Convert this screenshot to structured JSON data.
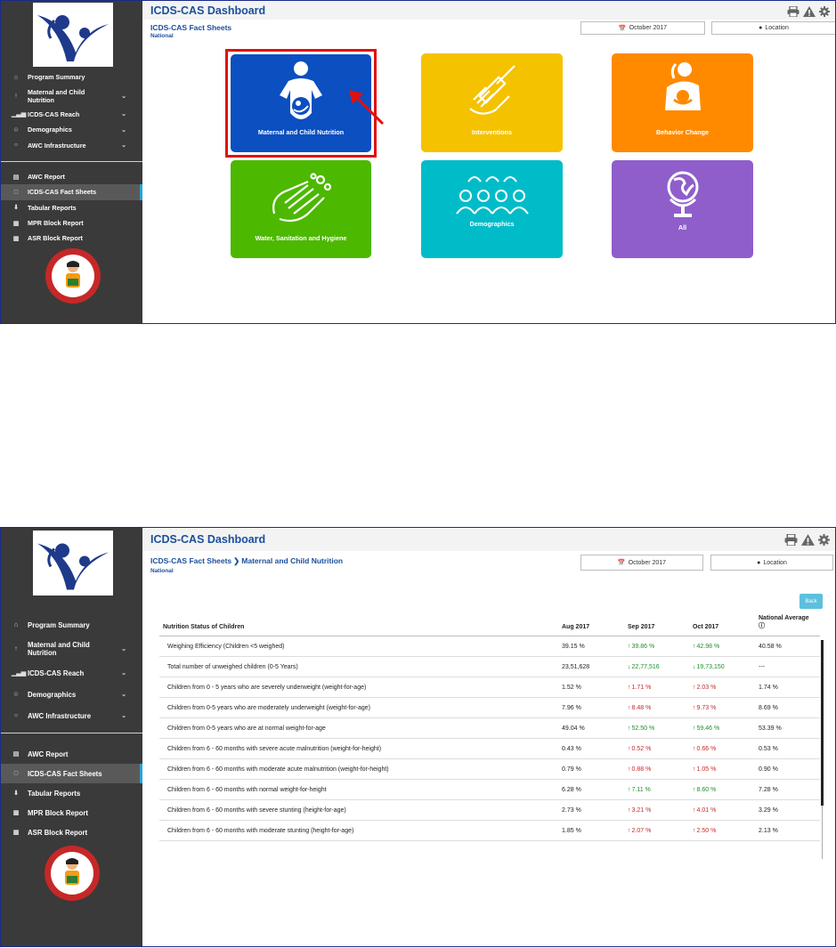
{
  "sidebar": {
    "nav_primary": [
      {
        "label": "Program Summary",
        "icon": "home-icon",
        "chevron": false
      },
      {
        "label": "Maternal and Child Nutrition",
        "icon": "child-icon",
        "chevron": true
      },
      {
        "label": "ICDS-CAS Reach",
        "icon": "bar-chart-icon",
        "chevron": true
      },
      {
        "label": "Demographics",
        "icon": "users-icon",
        "chevron": true
      },
      {
        "label": "AWC Infrastructure",
        "icon": "bulb-icon",
        "chevron": true
      }
    ],
    "nav_secondary": [
      {
        "label": "AWC Report",
        "icon": "report-icon",
        "active": false
      },
      {
        "label": "ICDS-CAS Fact Sheets",
        "icon": "file-icon",
        "active": true
      },
      {
        "label": "Tabular Reports",
        "icon": "download-icon",
        "active": false
      },
      {
        "label": "MPR Block Report",
        "icon": "grid-icon",
        "active": false
      },
      {
        "label": "ASR Block Report",
        "icon": "grid-icon",
        "active": false
      }
    ]
  },
  "screen1": {
    "title": "ICDS-CAS Dashboard",
    "subtitle": "ICDS-CAS Fact Sheets",
    "scope": "National",
    "date_button": "October 2017",
    "location_button": "Location",
    "tiles": [
      {
        "label": "Maternal and Child Nutrition",
        "color": "#0b4fc0",
        "icon": "pregnant-woman-icon"
      },
      {
        "label": "Interventions",
        "color": "#f5c200",
        "icon": "syringe-hand-icon"
      },
      {
        "label": "Behavior Change",
        "color": "#ff8a00",
        "icon": "mother-baby-icon"
      },
      {
        "label": "Water, Sanitation and Hygiene",
        "color": "#4cb800",
        "icon": "washing-hands-icon"
      },
      {
        "label": "Demographics",
        "color": "#00bcc9",
        "icon": "people-group-icon"
      },
      {
        "label": "All",
        "color": "#8f5ecb",
        "icon": "globe-icon"
      }
    ]
  },
  "screen2": {
    "title": "ICDS-CAS Dashboard",
    "breadcrumb_root": "ICDS-CAS Fact Sheets",
    "breadcrumb_current": "Maternal and Child Nutrition",
    "scope": "National",
    "date_button": "October 2017",
    "location_button": "Location",
    "back_button": "Back",
    "table": {
      "headers": [
        "Nutrition Status of Children",
        "Aug 2017",
        "Sep 2017",
        "Oct 2017",
        "National Average"
      ],
      "rows": [
        {
          "label": "Weighing Efficiency (Children <5 weighed)",
          "aug": "39.15 %",
          "sep": "39.86 %",
          "sep_dir": "up",
          "oct": "42.98 %",
          "oct_dir": "up",
          "avg": "40.58 %"
        },
        {
          "label": "Total number of unweighed children (0-5 Years)",
          "aug": "23,51,628",
          "sep": "22,77,516",
          "sep_dir": "down",
          "oct": "19,73,150",
          "oct_dir": "down",
          "avg": "---"
        },
        {
          "label": "Children from 0 - 5 years who are severely underweight (weight-for-age)",
          "aug": "1.52 %",
          "sep": "1.71 %",
          "sep_dir": "upbad",
          "oct": "2.03 %",
          "oct_dir": "upbad",
          "avg": "1.74 %"
        },
        {
          "label": "Children from 0-5 years who are moderately underweight (weight-for-age)",
          "aug": "7.96 %",
          "sep": "8.48 %",
          "sep_dir": "upbad",
          "oct": "9.73 %",
          "oct_dir": "upbad",
          "avg": "8.69 %"
        },
        {
          "label": "Children from 0-5 years who are at normal weight-for-age",
          "aug": "49.04 %",
          "sep": "52.50 %",
          "sep_dir": "up",
          "oct": "59.46 %",
          "oct_dir": "up",
          "avg": "53.39 %"
        },
        {
          "label": "Children from 6 - 60 months with severe acute malnutrition (weight-for-height)",
          "aug": "0.43 %",
          "sep": "0.52 %",
          "sep_dir": "upbad",
          "oct": "0.66 %",
          "oct_dir": "upbad",
          "avg": "0.53 %"
        },
        {
          "label": "Children from 6 - 60 months with moderate acute malnutrition (weight-for-height)",
          "aug": "0.79 %",
          "sep": "0.88 %",
          "sep_dir": "upbad",
          "oct": "1.05 %",
          "oct_dir": "upbad",
          "avg": "0.90 %"
        },
        {
          "label": "Children from 6 - 60 months with normal weight-for-height",
          "aug": "6.28 %",
          "sep": "7.11 %",
          "sep_dir": "up",
          "oct": "8.60 %",
          "oct_dir": "up",
          "avg": "7.28 %"
        },
        {
          "label": "Children from 6 - 60 months with severe stunting (height-for-age)",
          "aug": "2.73 %",
          "sep": "3.21 %",
          "sep_dir": "upbad",
          "oct": "4.01 %",
          "oct_dir": "upbad",
          "avg": "3.29 %"
        },
        {
          "label": "Children from 6 - 60 months with moderate stunting (height-for-age)",
          "aug": "1.85 %",
          "sep": "2.07 %",
          "sep_dir": "upbad",
          "oct": "2.50 %",
          "oct_dir": "upbad",
          "avg": "2.13 %"
        }
      ]
    }
  },
  "colors": {
    "header_text": "#1a4f9c",
    "sidebar_bg": "#3a3a3a",
    "active_accent": "#2aa3d6",
    "trend_good": "#1e8f2b",
    "trend_bad": "#c62828",
    "highlight": "#e01010"
  }
}
